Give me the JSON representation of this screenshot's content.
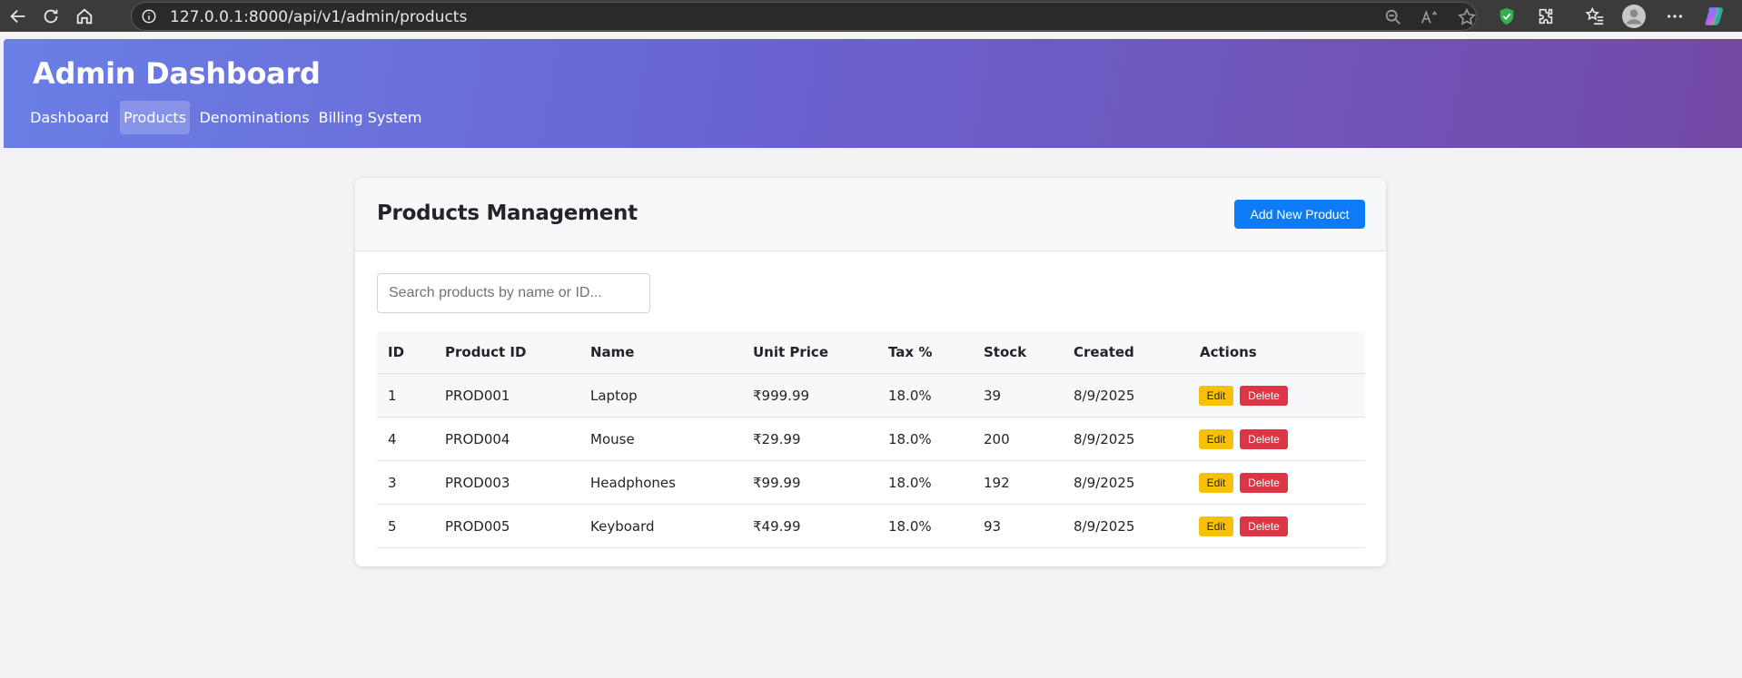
{
  "browser": {
    "url": "127.0.0.1:8000/api/v1/admin/products",
    "icons": [
      "back-arrow-icon",
      "refresh-icon",
      "home-icon",
      "info-icon",
      "zoom-out-icon",
      "read-aloud-icon",
      "favorite-star-icon",
      "shield-extension-icon",
      "extensions-puzzle-icon",
      "favorites-collection-icon",
      "profile-avatar-icon",
      "more-menu-icon",
      "copilot-icon"
    ]
  },
  "header": {
    "title": "Admin Dashboard",
    "nav": [
      {
        "label": "Dashboard",
        "active": false
      },
      {
        "label": "Products",
        "active": true
      },
      {
        "label": "Denominations",
        "active": false
      },
      {
        "label": "Billing System",
        "active": false
      }
    ]
  },
  "products": {
    "title": "Products Management",
    "add_button": "Add New Product",
    "search": {
      "placeholder": "Search products by name or ID...",
      "value": ""
    },
    "columns": [
      "ID",
      "Product ID",
      "Name",
      "Unit Price",
      "Tax %",
      "Stock",
      "Created",
      "Actions"
    ],
    "rows": [
      {
        "id": "1",
        "product_id": "PROD001",
        "name": "Laptop",
        "price": "₹999.99",
        "tax": "18.0%",
        "stock": "39",
        "created": "8/9/2025"
      },
      {
        "id": "4",
        "product_id": "PROD004",
        "name": "Mouse",
        "price": "₹29.99",
        "tax": "18.0%",
        "stock": "200",
        "created": "8/9/2025"
      },
      {
        "id": "3",
        "product_id": "PROD003",
        "name": "Headphones",
        "price": "₹99.99",
        "tax": "18.0%",
        "stock": "192",
        "created": "8/9/2025"
      },
      {
        "id": "5",
        "product_id": "PROD005",
        "name": "Keyboard",
        "price": "₹49.99",
        "tax": "18.0%",
        "stock": "93",
        "created": "8/9/2025"
      }
    ],
    "edit_label": "Edit",
    "delete_label": "Delete"
  },
  "colors": {
    "header_gradient_start": "#6a7fe6",
    "header_gradient_end": "#7449a6",
    "primary": "#0d7bf5",
    "warning": "#f7c00a",
    "danger": "#dc3545"
  }
}
